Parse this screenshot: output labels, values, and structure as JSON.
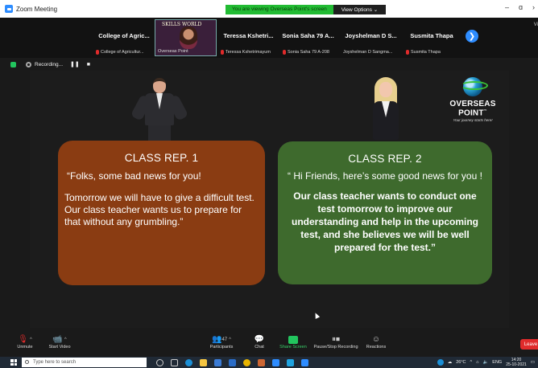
{
  "window": {
    "title": "Zoom Meeting"
  },
  "banner": {
    "message": "You are viewing Overseas Point's screen",
    "options_label": "View Options",
    "options_caret": "⌄"
  },
  "window_buttons": {
    "minimize": "–",
    "maximize": "ɑ",
    "close": "›"
  },
  "gallery": {
    "tiles": [
      {
        "name": "College of Agric...",
        "footer": "College of Agricultur...",
        "muted": true
      },
      {
        "name": "",
        "footer": "Overseas Point",
        "muted": false,
        "video": true,
        "overlay_text": "SKILLS WORLD"
      },
      {
        "name": "Teressa Kshetri...",
        "footer": "Teressa Kshetrimayum",
        "muted": true
      },
      {
        "name": "Sonia Saha 79 A...",
        "footer": "Sonia Saha 79 A-208",
        "muted": true
      },
      {
        "name": "Joyshelman D S...",
        "footer": "Joyshelman D Sangma...",
        "muted": true
      },
      {
        "name": "Susmita Thapa",
        "footer": "Susmita Thapa",
        "muted": true
      }
    ],
    "next_glyph": "❯",
    "view_label": "Vi"
  },
  "recording": {
    "label": "Recording...",
    "pause": "❚❚",
    "stop": "■"
  },
  "slide": {
    "brand": "OVERSEAS POINT",
    "brand_tm": "™",
    "tagline": "Your journey starts here!",
    "card1": {
      "title": "CLASS REP. 1",
      "line1": "“Folks, some bad news for you!",
      "line2": "Tomorrow we will have to give a difficult test. Our class teacher wants us to prepare for that without any grumbling.”"
    },
    "card2": {
      "title": "CLASS REP. 2",
      "line1": "“ Hi Friends, here’s some good news for you !",
      "line2": "Our class teacher wants to conduct one test tomorrow to improve our understanding and help in the upcoming test, and she believes we will be well prepared for the test.”"
    }
  },
  "controls": {
    "unmute": "Unmute",
    "start_video": "Start Video",
    "participants": "Participants",
    "participants_count": "47",
    "chat": "Chat",
    "share_screen": "Share Screen",
    "pause_stop": "Pause/Stop Recording",
    "reactions": "Reactions",
    "leave": "Leave",
    "caret": "^"
  },
  "taskbar": {
    "search_placeholder": "Type here to search",
    "weather": "26°C",
    "lang": "ENG",
    "time": "14:20",
    "date": "25-10-2021",
    "tray_caret": "^",
    "notify_glyph": "▭"
  },
  "colors": {
    "card1": "#8a3c12",
    "card2": "#3e6a2d",
    "share_green": "#22c55e",
    "zoom_blue": "#2d8cff",
    "leave_red": "#e02b2b"
  }
}
